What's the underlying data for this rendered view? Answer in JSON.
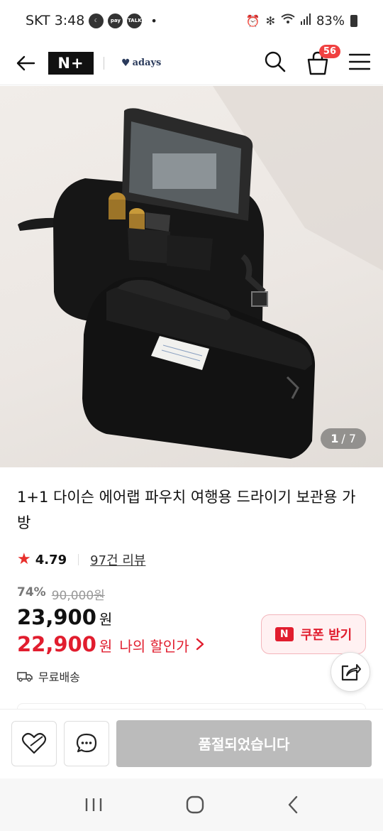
{
  "status_bar": {
    "carrier_time": "SKT 3:48",
    "battery": "83%",
    "icons": [
      "moon-icon",
      "pay-icon",
      "talk-icon",
      "alarm-icon",
      "bluetooth-icon",
      "wifi-icon",
      "signal-icon",
      "battery-icon"
    ],
    "pay_label": "pay",
    "talk_label": "TALK"
  },
  "header": {
    "logo": "N+",
    "brand": "adays",
    "cart_count": "56"
  },
  "gallery": {
    "current": "1",
    "total": "/ 7"
  },
  "product": {
    "title": "1+1 다이슨 에어랩 파우치 여행용 드라이기 보관용 가방",
    "rating": "4.79",
    "reviews": "97건 리뷰",
    "discount_pct": "74%",
    "original_price": "90,000원",
    "price": "23,900",
    "price_unit": "원",
    "my_price": "22,900",
    "my_price_unit": "원",
    "my_price_label": "나의 할인가",
    "shipping": "무료배송"
  },
  "coupon": {
    "logo": "N",
    "label": "쿠폰 받기"
  },
  "actions": {
    "soldout_label": "품절되었습니다"
  },
  "colors": {
    "accent_red": "#e11d2e",
    "soldout_gray": "#bbbbbb"
  }
}
